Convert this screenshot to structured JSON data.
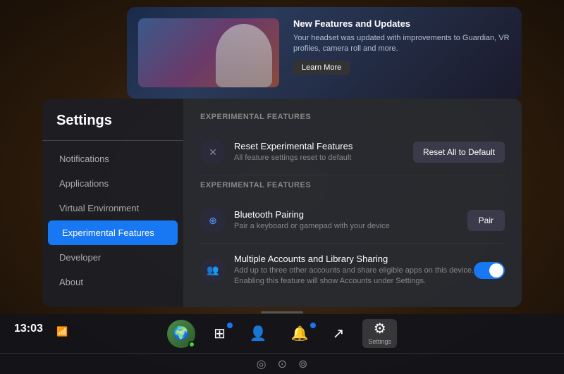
{
  "background": {
    "color": "#3a2a1a"
  },
  "banner": {
    "title": "New Features and Updates",
    "description": "Your headset was updated with improvements to Guardian, VR profiles, camera roll and more.",
    "link_label": "Learn More"
  },
  "sidebar": {
    "title": "Settings",
    "items": [
      {
        "id": "notifications",
        "label": "Notifications",
        "active": false
      },
      {
        "id": "applications",
        "label": "Applications",
        "active": false
      },
      {
        "id": "virtual-environment",
        "label": "Virtual Environment",
        "active": false
      },
      {
        "id": "experimental-features",
        "label": "Experimental Features",
        "active": true
      },
      {
        "id": "developer",
        "label": "Developer",
        "active": false
      },
      {
        "id": "about",
        "label": "About",
        "active": false
      }
    ]
  },
  "main": {
    "section1": {
      "title": "Experimental Features",
      "reset_row": {
        "icon": "✕",
        "name": "Reset Experimental Features",
        "description": "All feature settings reset to default",
        "button_label": "Reset All to Default"
      }
    },
    "section2": {
      "title": "Experimental Features",
      "items": [
        {
          "id": "bluetooth",
          "icon": "⊕",
          "name": "Bluetooth Pairing",
          "description": "Pair a keyboard or gamepad with your device",
          "action": "button",
          "button_label": "Pair"
        },
        {
          "id": "multiple-accounts",
          "icon": "👥",
          "name": "Multiple Accounts and Library Sharing",
          "description": "Add up to three other accounts and share eligible apps on this device. Enabling this feature will show Accounts under Settings.",
          "action": "toggle",
          "toggle_on": true
        }
      ]
    }
  },
  "taskbar": {
    "time": "13:03",
    "icons": [
      {
        "id": "home",
        "symbol": "⌂",
        "label": ""
      },
      {
        "id": "apps",
        "symbol": "⊞",
        "label": ""
      },
      {
        "id": "people",
        "symbol": "👤",
        "label": ""
      },
      {
        "id": "notification",
        "symbol": "🔔",
        "label": ""
      },
      {
        "id": "share",
        "symbol": "↗",
        "label": ""
      },
      {
        "id": "settings",
        "symbol": "⚙",
        "label": "Settings"
      }
    ],
    "bottom_icons": [
      "◎",
      "⊙",
      "⊚"
    ]
  }
}
